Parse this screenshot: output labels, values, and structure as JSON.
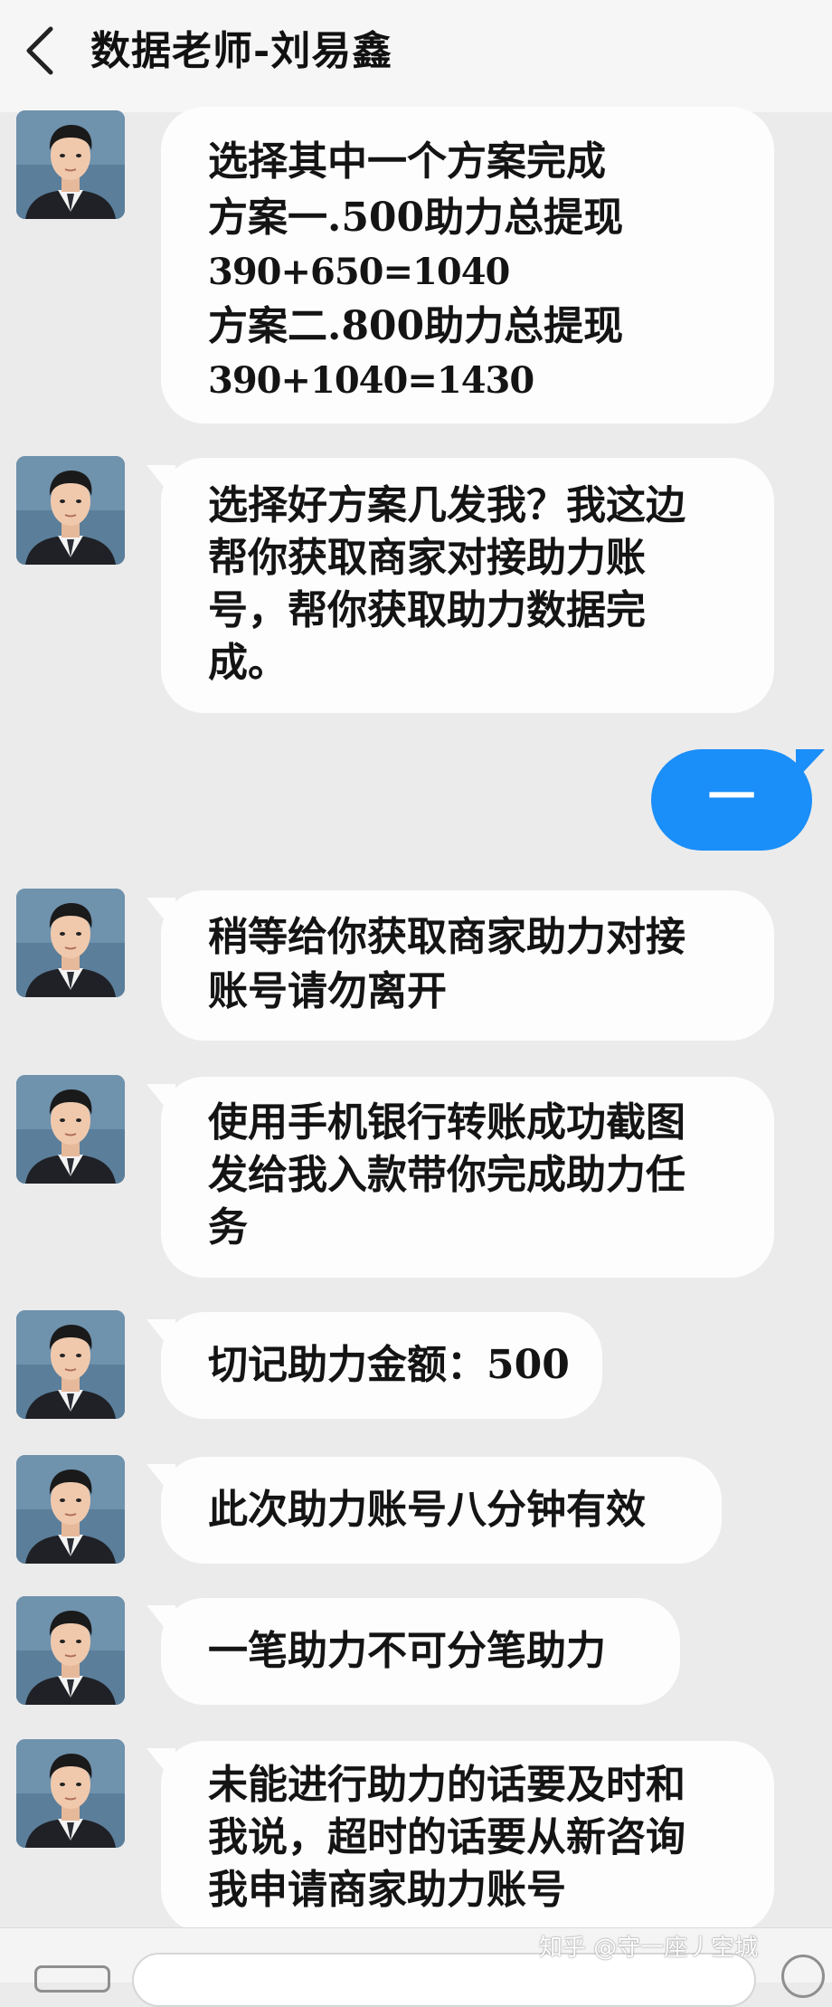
{
  "header": {
    "title": "数据老师-刘易鑫"
  },
  "messages": [
    {
      "lines": [
        "选择其中一个方案完成",
        "方案一.500助力总提现",
        "390+650=1040",
        "方案二.800助力总提现",
        "390+1040=1430"
      ]
    },
    {
      "lines": [
        "选择好方案几发我？我这边",
        "帮你获取商家对接助力账",
        "号，帮你获取助力数据完",
        "成。"
      ]
    },
    {
      "lines": [
        "稍等给你获取商家助力对接",
        "账号请勿离开"
      ]
    },
    {
      "lines": [
        "使用手机银行转账成功截图",
        "发给我入款带你完成助力任",
        "务"
      ]
    },
    {
      "lines": [
        "切记助力金额：500"
      ]
    },
    {
      "lines": [
        "此次助力账号八分钟有效"
      ]
    },
    {
      "lines": [
        "一笔助力不可分笔助力"
      ]
    },
    {
      "lines": [
        "未能进行助力的话要及时和",
        "我说，超时的话要从新咨询",
        "我申请商家助力账号"
      ]
    }
  ],
  "reply": {
    "text": "一"
  },
  "watermark": "知乎 @守一座丿空城",
  "colors": {
    "background": "#ebebeb",
    "reply_bubble": "#1a8ef9",
    "bubble": "#fdfdfd"
  }
}
